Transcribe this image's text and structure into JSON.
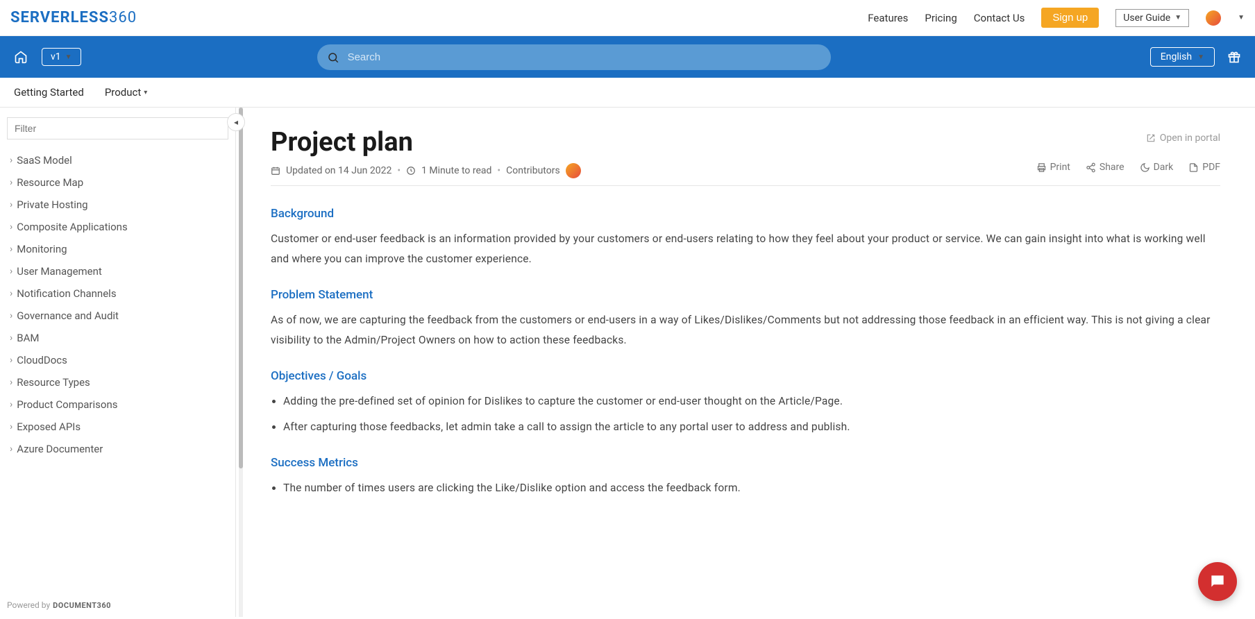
{
  "topbar": {
    "logo_main": "SERVERLESS",
    "logo_suffix": "360",
    "links": [
      "Features",
      "Pricing",
      "Contact Us"
    ],
    "signup": "Sign up",
    "userguide": "User Guide"
  },
  "bluebar": {
    "version": "v1",
    "search_placeholder": "Search",
    "language": "English"
  },
  "subnav": {
    "items": [
      "Getting Started",
      "Product"
    ]
  },
  "sidebar": {
    "filter_placeholder": "Filter",
    "items": [
      "SaaS Model",
      "Resource Map",
      "Private Hosting",
      "Composite Applications",
      "Monitoring",
      "User Management",
      "Notification Channels",
      "Governance and Audit",
      "BAM",
      "CloudDocs",
      "Resource Types",
      "Product Comparisons",
      "Exposed APIs",
      "Azure Documenter"
    ],
    "powered_prefix": "Powered by",
    "powered_brand": "DOCUMENT360"
  },
  "article": {
    "title": "Project plan",
    "open_portal": "Open in portal",
    "updated": "Updated on 14 Jun 2022",
    "read_time": "1 Minute to read",
    "contributors": "Contributors",
    "actions": {
      "print": "Print",
      "share": "Share",
      "dark": "Dark",
      "pdf": "PDF"
    },
    "sections": {
      "background": {
        "h": "Background",
        "p": "Customer or end-user feedback is an information provided by your customers or end-users relating to how they feel about your product or service. We can gain insight into what is working well and where you can improve the customer experience."
      },
      "problem": {
        "h": "Problem Statement",
        "p": "As of now, we are capturing the feedback from the customers or end-users in a way of Likes/Dislikes/Comments but not addressing those feedback in an efficient way. This is not giving a clear visibility to the Admin/Project Owners on how to action these feedbacks."
      },
      "objectives": {
        "h": "Objectives / Goals",
        "items": [
          "Adding the pre-defined set of opinion for Dislikes to capture the customer or end-user thought on the Article/Page.",
          "After capturing those feedbacks, let admin take a call to assign the article to any portal user to address and publish."
        ]
      },
      "success": {
        "h": "Success Metrics",
        "items": [
          "The number of times users are clicking the Like/Dislike option and access the feedback form."
        ]
      }
    }
  }
}
